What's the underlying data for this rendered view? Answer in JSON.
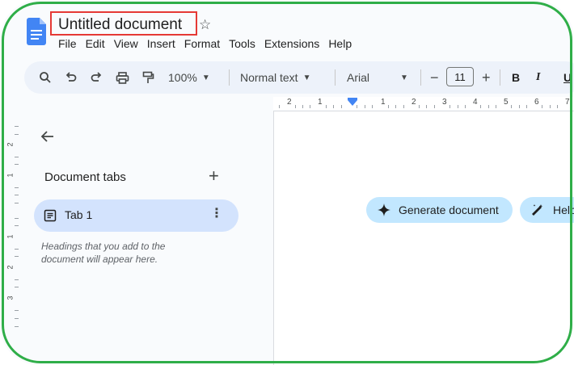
{
  "document": {
    "title": "Untitled document",
    "star_icon": "star-outline-icon"
  },
  "menu": [
    "File",
    "Edit",
    "View",
    "Insert",
    "Format",
    "Tools",
    "Extensions",
    "Help"
  ],
  "toolbar": {
    "zoom": "100%",
    "style": "Normal text",
    "font": "Arial",
    "font_size": "11",
    "minus": "−",
    "plus": "+",
    "bold": "B",
    "italic": "I",
    "underline": "U"
  },
  "ruler": {
    "top_numbers": [
      "2",
      "1",
      "1",
      "2",
      "3",
      "4",
      "5",
      "6",
      "7"
    ],
    "left_numbers": [
      "2",
      "1",
      "1",
      "2",
      "3"
    ]
  },
  "side_panel": {
    "heading": "Document tabs",
    "add_label": "+",
    "tabs": [
      {
        "label": "Tab 1",
        "more": "⋮"
      }
    ],
    "hint": "Headings that you add to the document will appear here."
  },
  "page": {
    "generate_label": "Generate document",
    "help_label": "Help"
  },
  "colors": {
    "frame": "#2fae48",
    "title_highlight": "#e53935",
    "toolbar_bg": "#edf2fa",
    "tab_selected": "#d3e3fd",
    "chip_bg": "#c2e7ff",
    "accent": "#4285f4"
  }
}
